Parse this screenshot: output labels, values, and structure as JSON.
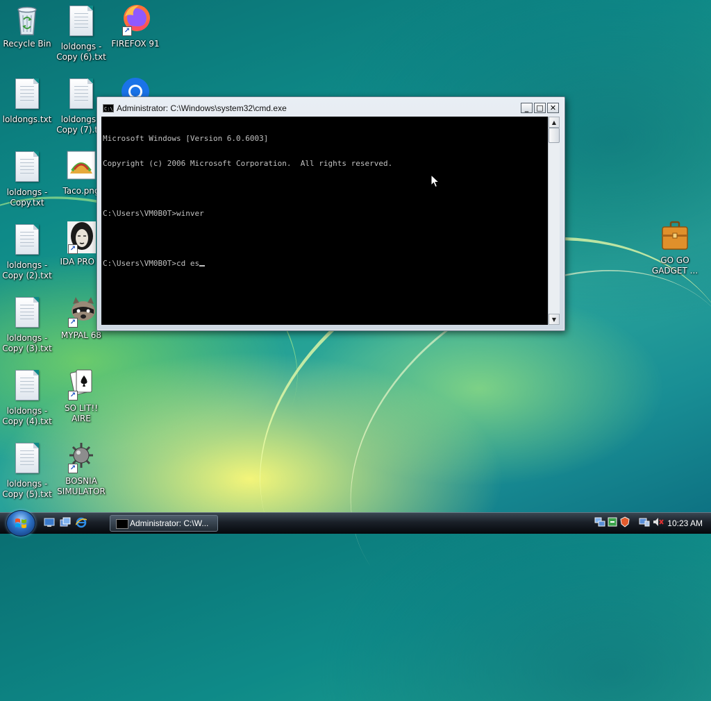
{
  "desktop": {
    "icons": [
      {
        "label": "Recycle Bin"
      },
      {
        "label": "loldongs - Copy (6).txt"
      },
      {
        "label": "FIREFOX 91"
      },
      {
        "label": "loldongs.txt"
      },
      {
        "label": "loldongs - Copy (7).txt"
      },
      {
        "label": "loldongs - Copy.txt"
      },
      {
        "label": "Taco.png"
      },
      {
        "label": "loldongs - Copy (2).txt"
      },
      {
        "label": "IDA PRO 6"
      },
      {
        "label": "loldongs - Copy (3).txt"
      },
      {
        "label": "MYPAL 68"
      },
      {
        "label": "loldongs - Copy (4).txt"
      },
      {
        "label": "SO LIT!! AIRE"
      },
      {
        "label": "loldongs - Copy (5).txt"
      },
      {
        "label": "BOSNIA SIMULATOR"
      },
      {
        "label": "GO GO GADGET ..."
      }
    ]
  },
  "cmd_window": {
    "title": "Administrator: C:\\Windows\\system32\\cmd.exe",
    "app_icon_text": "C:\\",
    "lines": [
      "Microsoft Windows [Version 6.0.6003]",
      "Copyright (c) 2006 Microsoft Corporation.  All rights reserved.",
      "",
      "C:\\Users\\VM0B0T>winver",
      "",
      "C:\\Users\\VM0B0T>cd es"
    ],
    "minimize_label": "_",
    "maximize_label": "□",
    "close_label": "✕",
    "scroll_up": "▲",
    "scroll_down": "▼"
  },
  "taskbar": {
    "task_button_label": "Administrator: C:\\W...",
    "clock": "10:23 AM"
  }
}
